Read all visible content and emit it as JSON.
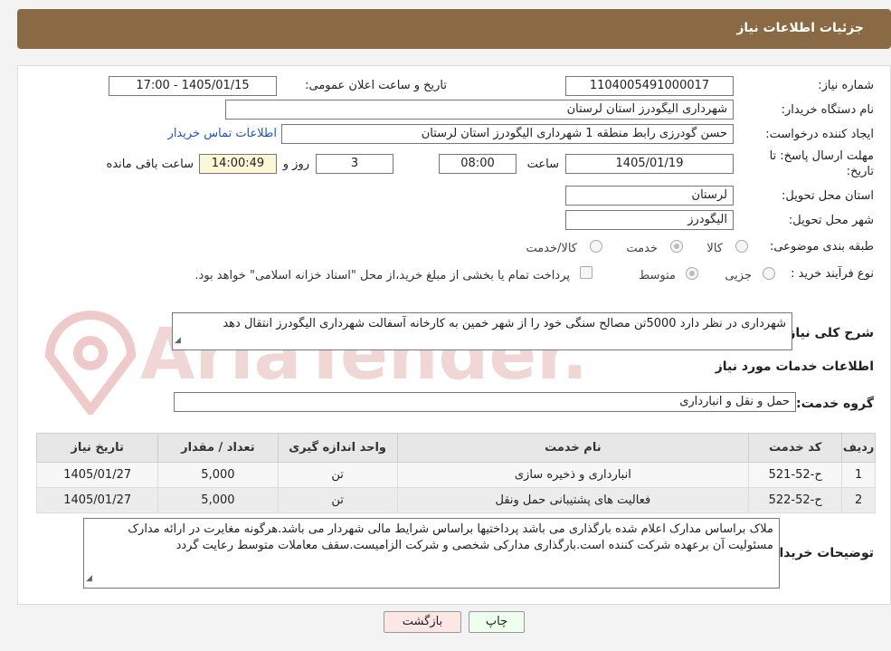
{
  "header": {
    "title": "جزئیات اطلاعات نیاز"
  },
  "form": {
    "need_number_label": "شماره نیاز:",
    "need_number": "1104005491000017",
    "announce_label": "تاریخ و ساعت اعلان عمومی:",
    "announce_value": "1405/01/15 - 17:00",
    "buyer_org_label": "نام دستگاه خریدار:",
    "buyer_org": "شهرداری الیگودرز استان لرستان",
    "requester_label": "ایجاد کننده درخواست:",
    "requester": "حسن گودرزی رابط منطقه 1 شهرداری الیگودرز استان لرستان",
    "contact_link": "اطلاعات تماس خریدار",
    "deadline_label_1": "مهلت ارسال پاسخ: تا",
    "deadline_label_2": "تاریخ:",
    "deadline_date": "1405/01/19",
    "time_label": "ساعت",
    "deadline_time": "08:00",
    "days_value": "3",
    "days_label": "روز و",
    "remaining_time": "14:00:49",
    "remaining_label": "ساعت باقی مانده",
    "province_label": "استان محل تحویل:",
    "province": "لرستان",
    "city_label": "شهر محل تحویل:",
    "city": "الیگودرز",
    "category_label": "طبقه بندی موضوعی:",
    "category_options": [
      "کالا",
      "خدمت",
      "کالا/خدمت"
    ],
    "category_selected": "خدمت",
    "process_label": "نوع فرآیند خرید :",
    "process_options": [
      "جزیی",
      "متوسط"
    ],
    "process_selected": "متوسط",
    "payment_note": "پرداخت تمام یا بخشی از مبلغ خرید،از محل \"اسناد خزانه اسلامی\" خواهد بود.",
    "description_label": "شرح کلی نیاز:",
    "description": "شهرداری در نظر دارد 5000تن مصالح سنگی خود را از شهر خمین به کارخانه آسفالت شهرداری الیگودرز انتقال دهد"
  },
  "services": {
    "section_title": "اطلاعات خدمات مورد نیاز",
    "group_label": "گروه خدمت:",
    "group_value": "حمل و نقل و انبارداری",
    "columns": [
      "ردیف",
      "کد خدمت",
      "نام خدمت",
      "واحد اندازه گیری",
      "تعداد / مقدار",
      "تاریخ نیاز"
    ],
    "rows": [
      {
        "idx": "1",
        "code": "ح-52-521",
        "name": "انبارداری و ذخیره سازی",
        "unit": "تن",
        "qty": "5,000",
        "date": "1405/01/27"
      },
      {
        "idx": "2",
        "code": "ح-52-522",
        "name": "فعالیت های پشتیبانی حمل ونقل",
        "unit": "تن",
        "qty": "5,000",
        "date": "1405/01/27"
      }
    ]
  },
  "buyer_notes": {
    "label": "توضیحات خریدار:",
    "text": "ملاک براساس مدارک اعلام شده بارگذاری می باشد پرداختیها براساس شرایط مالی شهردار می باشد.هرگونه مغایرت در ارائه مدارک مسئولیت آن برعهده شرکت کننده است.بارگذاری مدارکی شخصی و شرکت الزامیست.سقف معاملات متوسط رعایت گردد"
  },
  "buttons": {
    "print": "چاپ",
    "back": "بازگشت"
  },
  "watermark": {
    "text": "AriaTender.neT",
    "color": "#e9b8b8"
  }
}
